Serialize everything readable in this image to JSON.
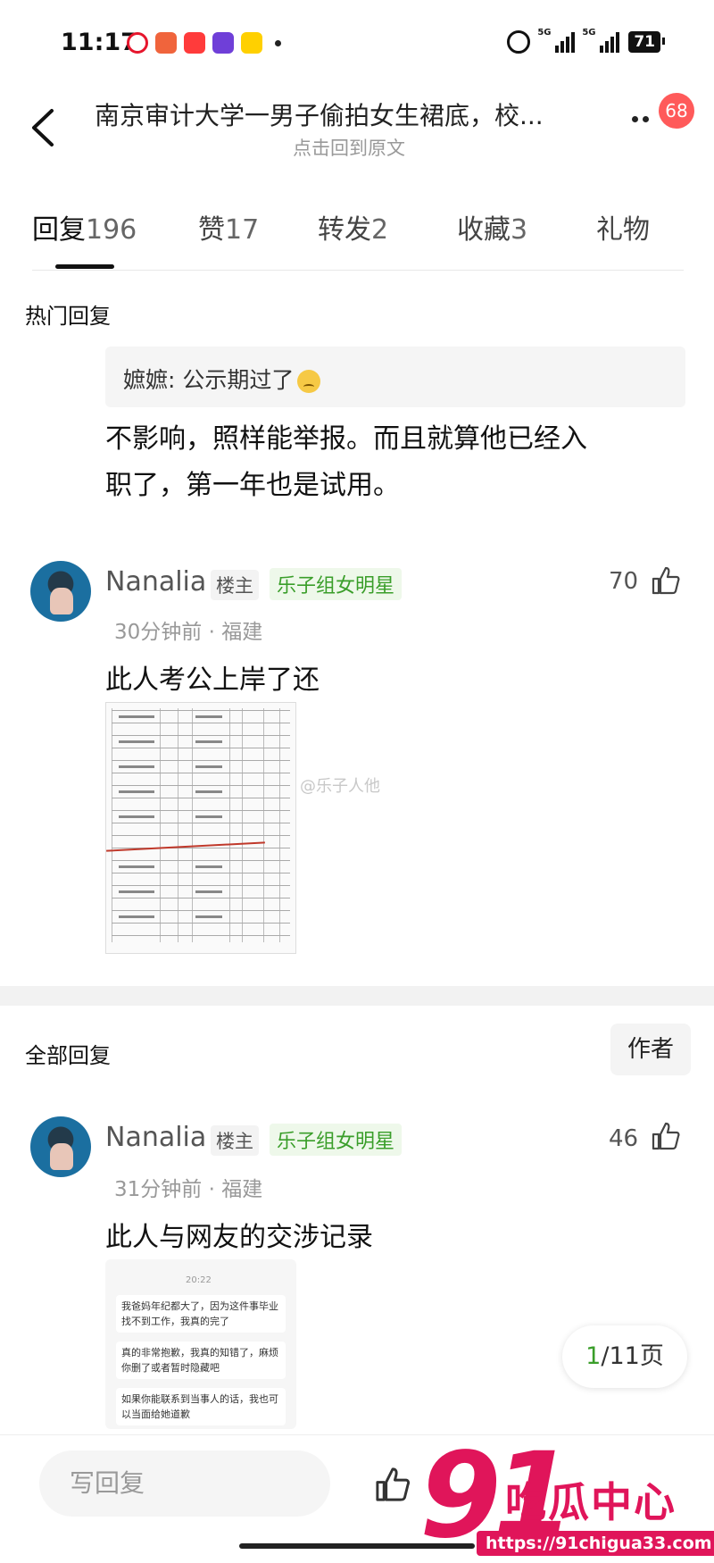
{
  "status_bar": {
    "time": "11:17",
    "signal1": "5G",
    "signal2": "5G",
    "battery": "71"
  },
  "header": {
    "title": "南京审计大学一男子偷拍女生裙底，校...",
    "subtitle": "点击回到原文",
    "notification_count": "68"
  },
  "tabs": [
    {
      "label": "回复",
      "count": "196"
    },
    {
      "label": "赞",
      "count": "17"
    },
    {
      "label": "转发",
      "count": "2"
    },
    {
      "label": "收藏",
      "count": "3"
    },
    {
      "label": "礼物",
      "count": ""
    }
  ],
  "hot_section": {
    "title": "热门回复",
    "quote": {
      "author": "嫬嫬",
      "text": "公示期过了"
    },
    "reply_lines": [
      "不影响，照样能举报。而且就算他已经入",
      "职了，第一年也是试用。"
    ],
    "comment": {
      "username": "Nanalia",
      "op_tag": "楼主",
      "fan_tag": "乐子组女明星",
      "meta": "30分钟前 · 福建",
      "likes": "70",
      "text": "此人考公上岸了还",
      "image_watermark": "@乐子人他"
    }
  },
  "all_section": {
    "title": "全部回复",
    "author_button": "作者",
    "comment": {
      "username": "Nanalia",
      "op_tag": "楼主",
      "fan_tag": "乐子组女明星",
      "meta": "31分钟前 · 福建",
      "likes": "46",
      "text": "此人与网友的交涉记录"
    },
    "chat_image": {
      "time": "20:22",
      "bubbles": [
        "我爸妈年纪都大了，因为这件事毕业找不到工作，我真的完了",
        "真的非常抱歉，我真的知错了，麻烦你删了或者暂时隐藏吧",
        "如果你能联系到当事人的话，我也可以当面给她道歉"
      ]
    }
  },
  "pagination": {
    "current": "1",
    "total": "/11页"
  },
  "bottom_bar": {
    "reply_placeholder": "写回复"
  },
  "watermark_logo": {
    "number": "91",
    "name": "吃瓜中心",
    "url": "https://91chigua33.com"
  },
  "colors": {
    "accent_green": "#3a9e2a",
    "badge_red": "#ff5a5a",
    "logo_pink": "#e0155a"
  }
}
